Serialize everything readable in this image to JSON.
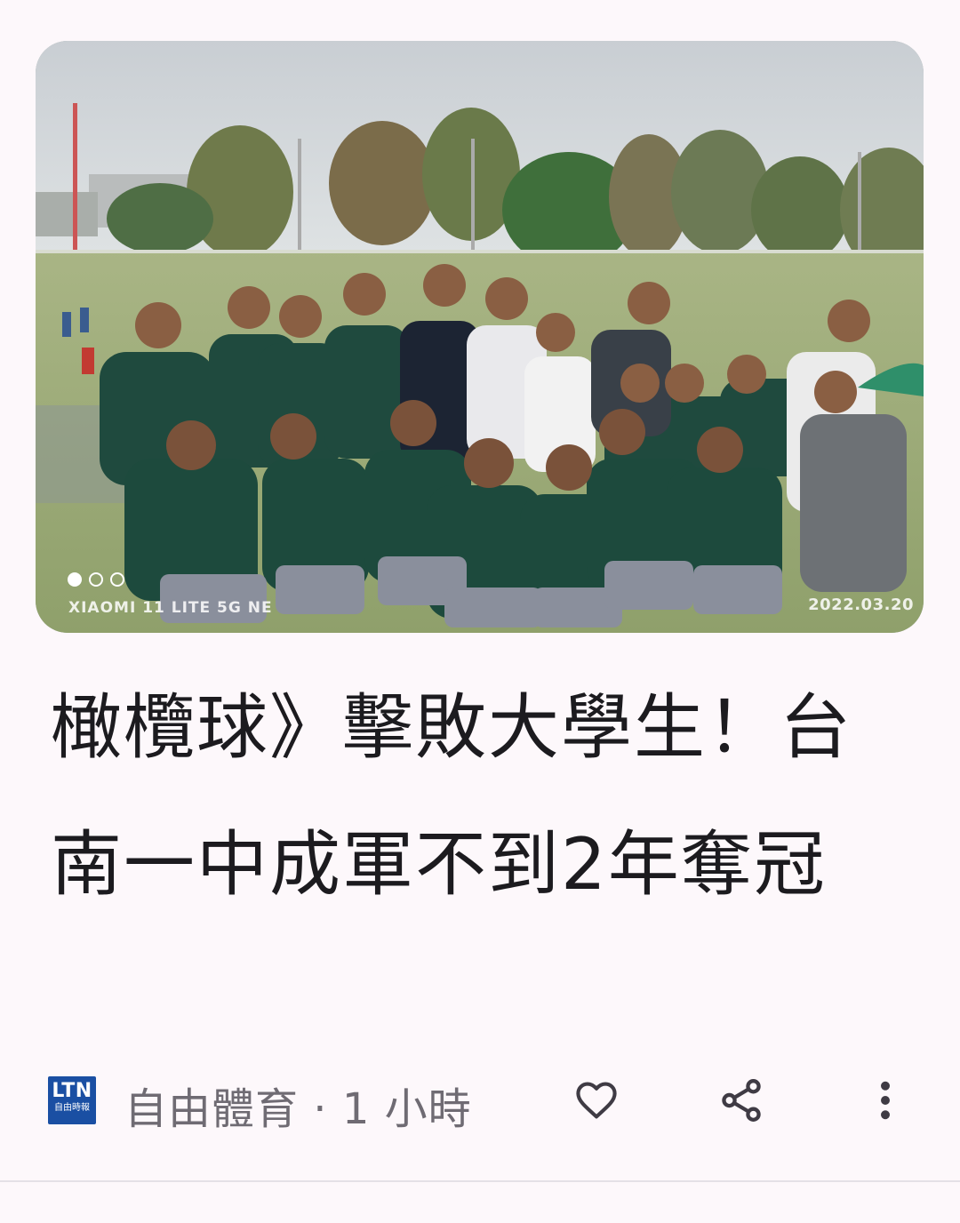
{
  "article": {
    "image": {
      "alt": "",
      "watermark_camera": "XIAOMI 11 LITE 5G NE",
      "watermark_date": "2022.03.20",
      "carousel": {
        "total": 3,
        "active_index": 0
      }
    },
    "headline": "橄欖球》擊敗大學生！台南一中成軍不到2年奪冠",
    "source": {
      "logo_text": "LTN",
      "logo_subtext": "自由時報",
      "name": "自由體育",
      "separator": "·",
      "time": "1 小時"
    },
    "actions": {
      "like_icon": "heart-outline-icon",
      "share_icon": "share-icon",
      "more_icon": "more-vertical-icon"
    }
  },
  "colors": {
    "background": "#fdf8fb",
    "headline": "#1c1b1f",
    "meta_text": "#6f6b73",
    "logo_bg": "#1a4fa3",
    "icon": "#3f3b44"
  }
}
